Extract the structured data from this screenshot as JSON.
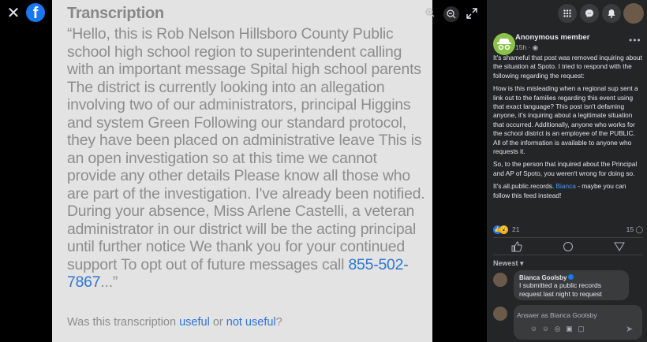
{
  "viewer": {
    "close_glyph": "✕",
    "logo_letter": "f",
    "photo": {
      "heading": "Transcription",
      "body": "“Hello, this is Rob Nelson Hillsboro County Public school high school region to superintendent calling with an important message Spital high school parents The district is currently looking into an allegation involving two of our administrators, principal Higgins and system Green Following our standard protocol, they have been placed on administrative leave This is an open investigation so at this time we cannot provide any other details Please know all those who are part of the investigation. I've already been notified. During your absence, Miss Arlene Castelli, a veteran administrator in our district will be the acting principal until further notice We thank you for your continued support To opt out of future messages call ",
      "phone": "855-502-7867",
      "body_end": "...”",
      "footer_prefix": "Was this transcription ",
      "footer_useful": "useful",
      "footer_or": " or ",
      "footer_not_useful": "not useful",
      "footer_suffix": "?"
    },
    "icons": [
      "close-icon",
      "facebook-logo-icon",
      "zoom-in-icon",
      "zoom-out-icon",
      "expand-icon"
    ]
  },
  "header_icons": [
    "menu-grid-icon",
    "messenger-icon",
    "notifications-icon",
    "profile-avatar-icon"
  ],
  "post": {
    "author": "Anonymous member",
    "time": "15h",
    "paragraphs": [
      "It's shameful that post was removed inquiring about the situation at Spoto. I tried to respond with the following regarding the request:",
      "How is this misleading when a regional sup sent a link out to the families regarding this event using that exact language? This post isn't defaming anyone, it's inquiring about a legitimate situation that occurred. Additionally, anyone who works for the school district is an employee of the PUBLIC. All of the information is available to anyone who requests it.",
      "So, to the person that inquired about the Principal and AP of Spoto, you weren't wrong for doing so."
    ],
    "last_prefix": "It's.all.public.records. ",
    "last_tag": "Bianca",
    "last_suffix": " - maybe you can follow this feed instead!",
    "reactions_count": "21",
    "comments_count": "15"
  },
  "comments": {
    "sort_label": "Newest",
    "items": [
      {
        "name": "Bianca Goolsby",
        "text": "I submitted a public records request last night to request"
      }
    ],
    "reply_placeholder": "Answer as Bianca Goolsby"
  },
  "colors": {
    "accent": "#1877f2",
    "panel_bg": "#242526",
    "link": "#4599ff",
    "anon_avatar": "#8bc34a"
  }
}
